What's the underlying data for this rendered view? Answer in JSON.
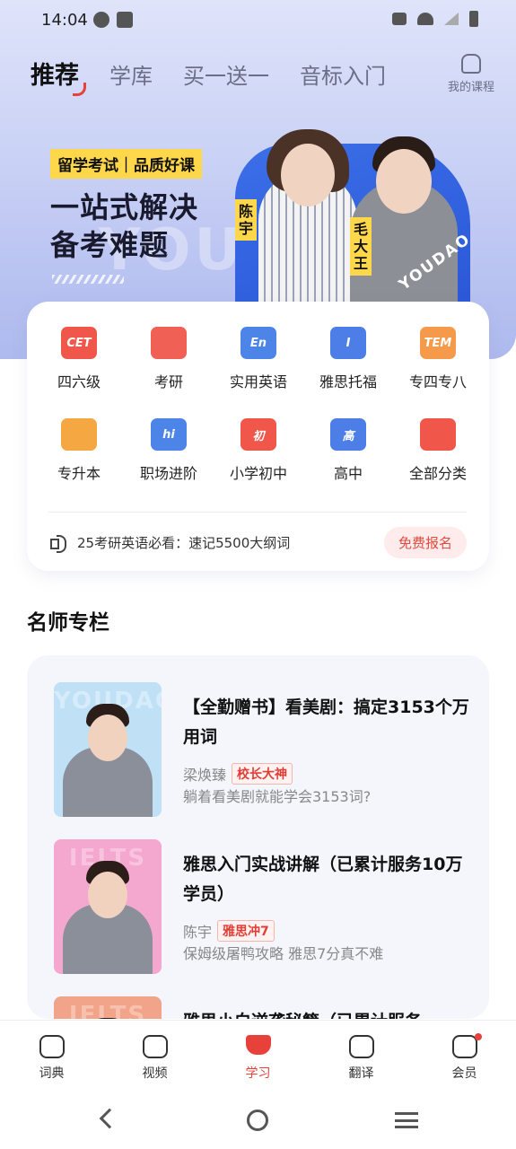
{
  "status_bar": {
    "time": "14:04"
  },
  "tabs": [
    {
      "label": "推荐",
      "active": true
    },
    {
      "label": "学库",
      "active": false
    },
    {
      "label": "买一送一",
      "active": false
    },
    {
      "label": "音标入门",
      "active": false
    }
  ],
  "my_course_label": "我的课程",
  "banner": {
    "tag": "留学考试｜品质好课",
    "title_line1": "一站式解决",
    "title_line2": "备考难题",
    "teacher1": "陈宇",
    "teacher2": "毛大王",
    "brand": "YOUDAO"
  },
  "categories": [
    {
      "label": "四六级",
      "icon_text": "CET",
      "color": "#f0564a"
    },
    {
      "label": "考研",
      "icon_text": "",
      "color": "#f06054"
    },
    {
      "label": "实用英语",
      "icon_text": "En",
      "color": "#4d84e8"
    },
    {
      "label": "雅思托福",
      "icon_text": "I",
      "color": "#4d7ee8"
    },
    {
      "label": "专四专八",
      "icon_text": "TEM",
      "color": "#f59a4a"
    },
    {
      "label": "专升本",
      "icon_text": "",
      "color": "#f5a742"
    },
    {
      "label": "职场进阶",
      "icon_text": "hi",
      "color": "#4d84e8"
    },
    {
      "label": "小学初中",
      "icon_text": "初",
      "color": "#f0564a"
    },
    {
      "label": "高中",
      "icon_text": "高",
      "color": "#4d7ee8"
    },
    {
      "label": "全部分类",
      "icon_text": "",
      "color": "#f0564a"
    }
  ],
  "notice": {
    "text": "25考研英语必看：速记5500大纲词",
    "button": "免费报名"
  },
  "section_title": "名师专栏",
  "courses": [
    {
      "title": "【全勤赠书】看美剧：搞定3153个万用词",
      "teacher": "梁焕臻",
      "badge": "校长大神",
      "desc": "躺着看美剧就能学会3153词?",
      "thumb_text": "YOUDAO",
      "thumb_bg": "#bfe0f5",
      "thumb_text_color": "#d6ecfa"
    },
    {
      "title": "雅思入门实战讲解（已累计服务10万学员）",
      "teacher": "陈宇",
      "badge": "雅思冲7",
      "desc": "保姆级屠鸭攻略 雅思7分真不难",
      "thumb_text": "IELTS",
      "thumb_bg": "#f4a7cf",
      "thumb_text_color": "#f7c3de"
    },
    {
      "title": "雅思小白逆袭秘籍（已累计服务",
      "teacher": "",
      "badge": "",
      "desc": "",
      "thumb_text": "IELTS",
      "thumb_bg": "#f2a48a",
      "thumb_text_color": "#f7c1ae"
    }
  ],
  "bottom_nav": [
    {
      "label": "词典",
      "icon": "dictionary-icon",
      "active": false
    },
    {
      "label": "视频",
      "icon": "video-icon",
      "active": false
    },
    {
      "label": "学习",
      "icon": "graduation-cap-icon",
      "active": true
    },
    {
      "label": "翻译",
      "icon": "translate-icon",
      "active": false
    },
    {
      "label": "会员",
      "icon": "vip-icon",
      "active": false
    }
  ]
}
